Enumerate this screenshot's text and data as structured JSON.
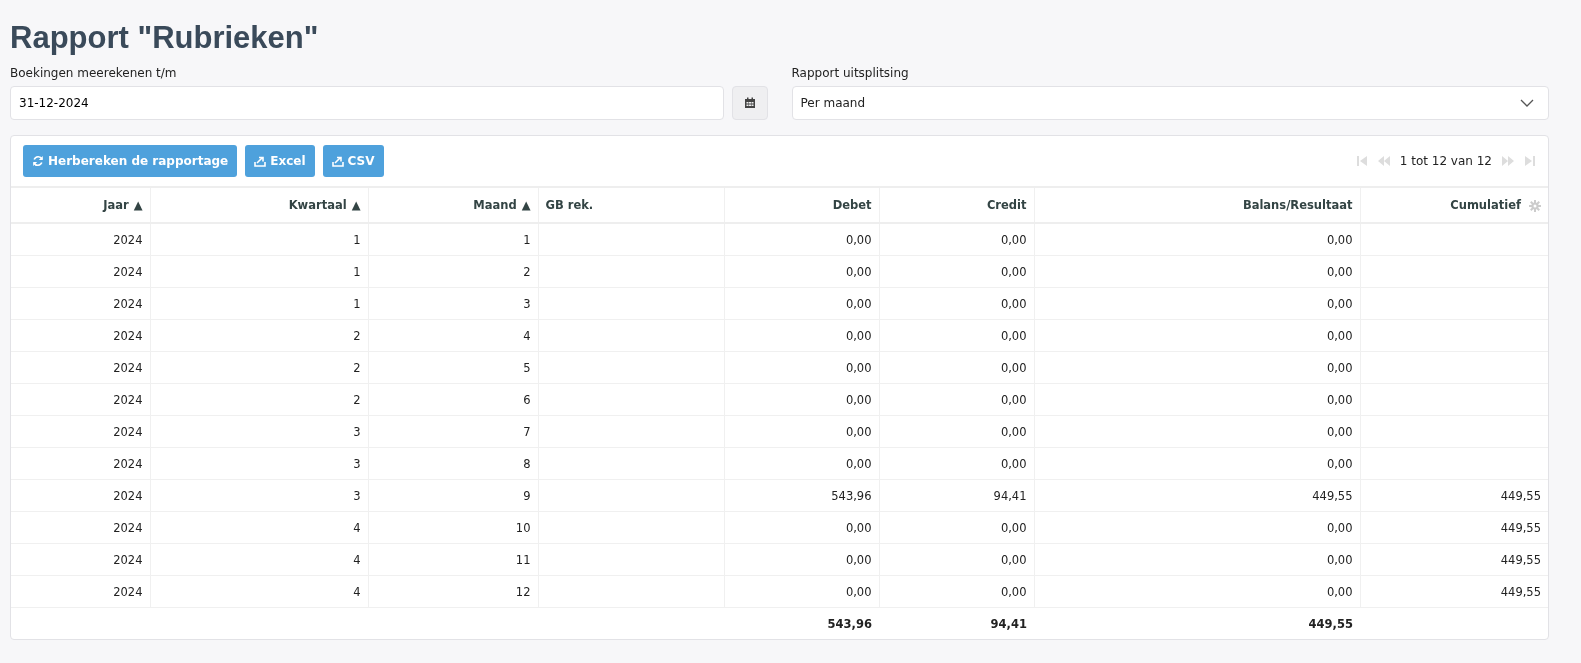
{
  "title": "Rapport \"Rubrieken\"",
  "date_field": {
    "label": "Boekingen meerekenen t/m",
    "value": "31-12-2024"
  },
  "split_field": {
    "label": "Rapport uitsplitsing",
    "value": "Per maand"
  },
  "toolbar": {
    "buttons": [
      {
        "kind": "refresh",
        "label": "Herbereken de rapportage"
      },
      {
        "kind": "export",
        "label": "Excel"
      },
      {
        "kind": "export",
        "label": "CSV"
      }
    ],
    "pager": {
      "text": "1 tot 12 van 12",
      "buttons": [
        {
          "kind": "first",
          "disabled": true
        },
        {
          "kind": "prev",
          "disabled": true
        },
        {
          "kind": "next",
          "disabled": true
        },
        {
          "kind": "last",
          "disabled": true
        }
      ]
    }
  },
  "table": {
    "columns": [
      {
        "label": "Jaar",
        "sort": "▲",
        "kind": "number"
      },
      {
        "label": "Kwartaal",
        "sort": "▲",
        "kind": "number"
      },
      {
        "label": "Maand",
        "sort": "▲",
        "kind": "number"
      },
      {
        "label": "GB rek.",
        "kind": "text"
      },
      {
        "label": "Debet",
        "kind": "number"
      },
      {
        "label": "Credit",
        "kind": "number"
      },
      {
        "label": "Balans/Resultaat",
        "kind": "number"
      },
      {
        "label": "Cumulatief",
        "kind": "number",
        "settings": true
      }
    ],
    "rows": [
      [
        "2024",
        "1",
        "1",
        "",
        "0,00",
        "0,00",
        "0,00",
        ""
      ],
      [
        "2024",
        "1",
        "2",
        "",
        "0,00",
        "0,00",
        "0,00",
        ""
      ],
      [
        "2024",
        "1",
        "3",
        "",
        "0,00",
        "0,00",
        "0,00",
        ""
      ],
      [
        "2024",
        "2",
        "4",
        "",
        "0,00",
        "0,00",
        "0,00",
        ""
      ],
      [
        "2024",
        "2",
        "5",
        "",
        "0,00",
        "0,00",
        "0,00",
        ""
      ],
      [
        "2024",
        "2",
        "6",
        "",
        "0,00",
        "0,00",
        "0,00",
        ""
      ],
      [
        "2024",
        "3",
        "7",
        "",
        "0,00",
        "0,00",
        "0,00",
        ""
      ],
      [
        "2024",
        "3",
        "8",
        "",
        "0,00",
        "0,00",
        "0,00",
        ""
      ],
      [
        "2024",
        "3",
        "9",
        "",
        "543,96",
        "94,41",
        "449,55",
        "449,55"
      ],
      [
        "2024",
        "4",
        "10",
        "",
        "0,00",
        "0,00",
        "0,00",
        "449,55"
      ],
      [
        "2024",
        "4",
        "11",
        "",
        "0,00",
        "0,00",
        "0,00",
        "449,55"
      ],
      [
        "2024",
        "4",
        "12",
        "",
        "0,00",
        "0,00",
        "0,00",
        "449,55"
      ]
    ],
    "totals": {
      "debet": "543,96",
      "credit": "94,41",
      "balans": "449,55"
    }
  }
}
